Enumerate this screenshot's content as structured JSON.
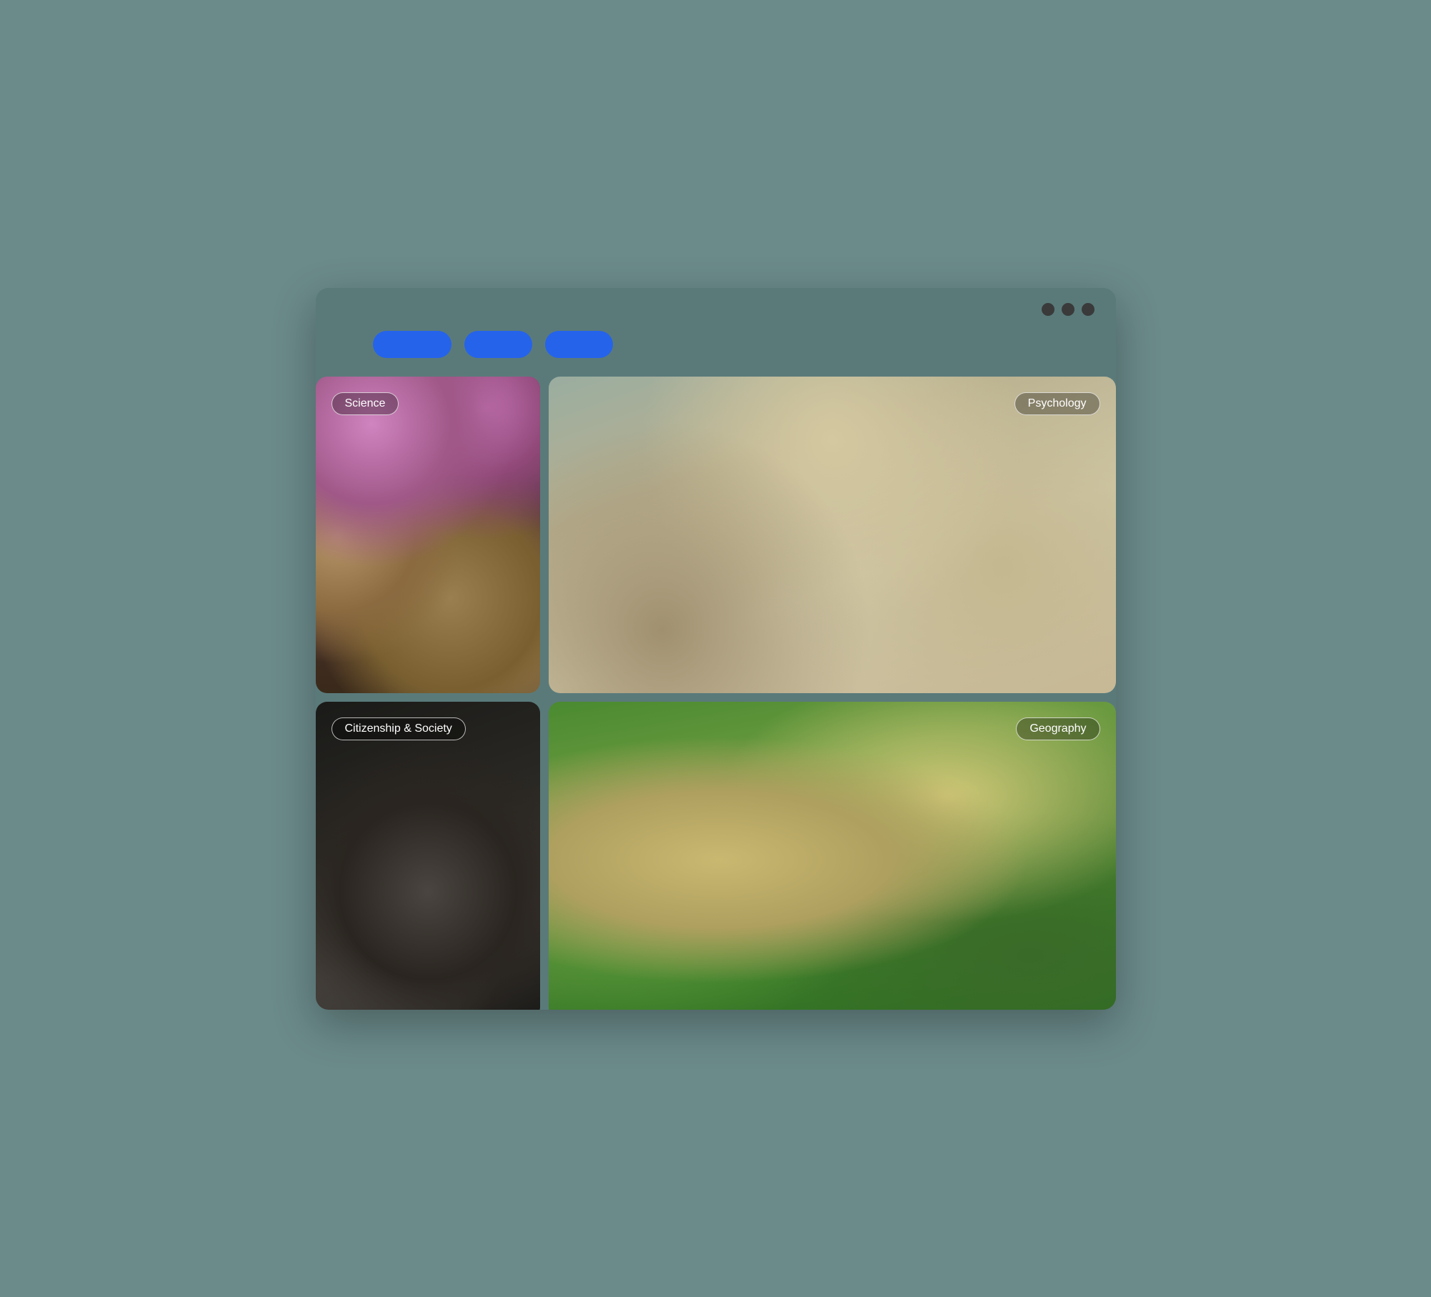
{
  "window": {
    "controls": [
      "dot1",
      "dot2",
      "dot3"
    ]
  },
  "toolbar": {
    "buttons": [
      {
        "label": "",
        "id": "btn1"
      },
      {
        "label": "",
        "id": "btn2"
      },
      {
        "label": "",
        "id": "btn3"
      }
    ]
  },
  "cards": [
    {
      "id": "science",
      "category": "Science",
      "position": "top-left"
    },
    {
      "id": "psychology",
      "category": "Psychology",
      "position": "top-right"
    },
    {
      "id": "citizenship",
      "category": "Citizenship & Society",
      "position": "bottom-left"
    },
    {
      "id": "geography",
      "category": "Geography",
      "position": "bottom-right"
    }
  ]
}
